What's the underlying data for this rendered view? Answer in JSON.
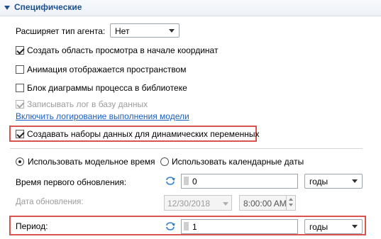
{
  "section": {
    "title": "Специфические"
  },
  "agent_type": {
    "label": "Расширяет тип агента:",
    "value": "Нет"
  },
  "checkboxes": [
    {
      "label": "Создать область просмотра в начале координат",
      "checked": true,
      "disabled": false
    },
    {
      "label": "Анимация отображается пространством",
      "checked": false,
      "disabled": false
    },
    {
      "label": "Блок диаграммы процесса в библиотеке",
      "checked": false,
      "disabled": false
    },
    {
      "label": "Записывать лог в базу данных",
      "checked": true,
      "disabled": true
    }
  ],
  "logging_link": "Включить логирование выполнения модели",
  "dynamic_vars": {
    "label": "Создавать наборы данных для динамических переменных",
    "checked": true
  },
  "time_mode": {
    "model_time": "Использовать модельное время",
    "calendar_dates": "Использовать календарные даты",
    "selected": "model_time"
  },
  "first_update": {
    "label": "Время первого обновления:",
    "value": "0",
    "unit": "годы"
  },
  "update_date": {
    "label": "Дата обновления:",
    "date": "12/30/2018",
    "time": "8:00:00 AM"
  },
  "period": {
    "label": "Период:",
    "value": "1",
    "unit": "годы"
  }
}
